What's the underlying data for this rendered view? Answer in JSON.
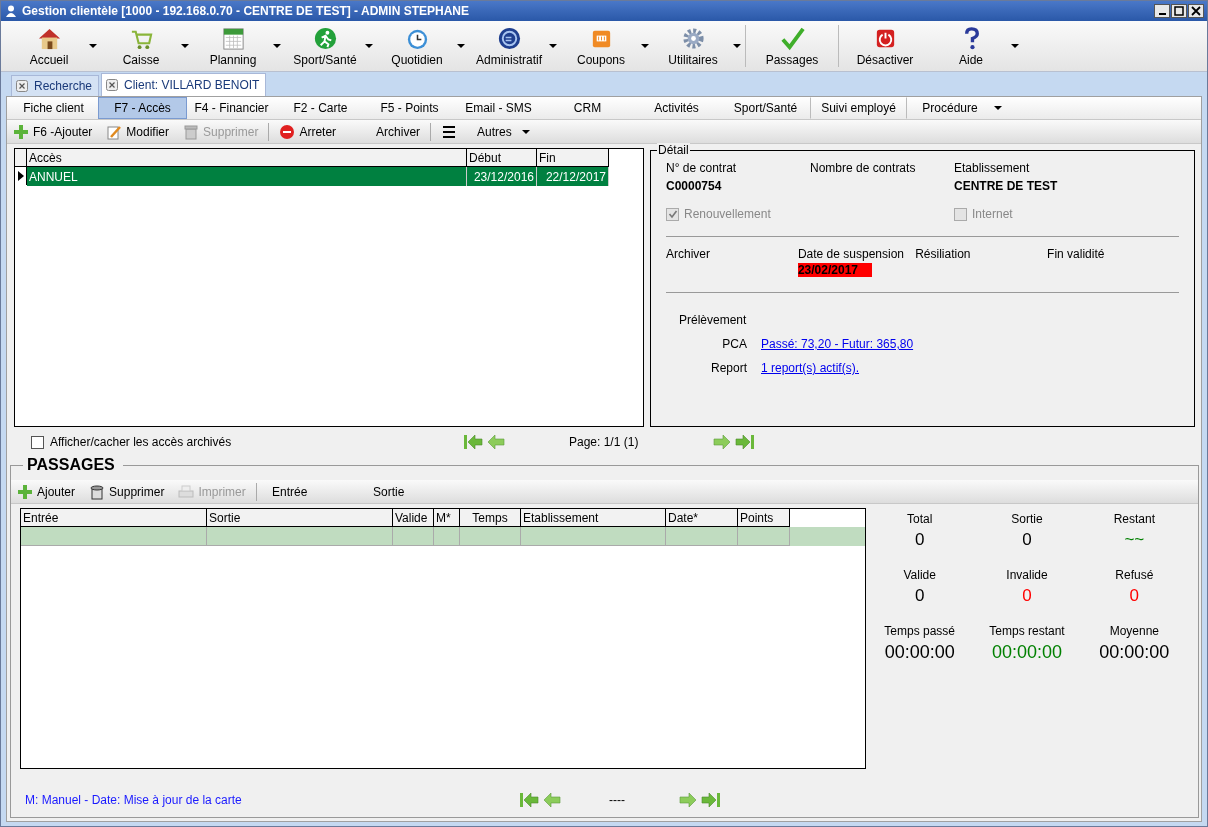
{
  "window": {
    "title": "Gestion clientèle [1000 - 192.168.0.70 - CENTRE DE TEST] - ADMIN STEPHANE"
  },
  "ribbon": [
    {
      "label": "Accueil",
      "dropdown": true
    },
    {
      "label": "Caisse",
      "dropdown": true
    },
    {
      "label": "Planning",
      "dropdown": true
    },
    {
      "label": "Sport/Santé",
      "dropdown": true
    },
    {
      "label": "Quotidien",
      "dropdown": true
    },
    {
      "label": "Administratif",
      "dropdown": true
    },
    {
      "label": "Coupons",
      "dropdown": true
    },
    {
      "label": "Utilitaires",
      "dropdown": true
    },
    {
      "label": "Passages",
      "dropdown": false
    },
    {
      "label": "Désactiver",
      "dropdown": false
    },
    {
      "label": "Aide",
      "dropdown": true
    }
  ],
  "doc_tabs": [
    {
      "label": "Recherche",
      "selected": false
    },
    {
      "label": "Client: VILLARD BENOIT",
      "selected": true
    }
  ],
  "sub_tabs": [
    {
      "label": "Fiche client",
      "selected": false,
      "dropdown": false
    },
    {
      "label": "F7 - Accès",
      "selected": true,
      "dropdown": false
    },
    {
      "label": "F4 - Financier",
      "selected": false,
      "dropdown": false
    },
    {
      "label": "F2 - Carte",
      "selected": false,
      "dropdown": false
    },
    {
      "label": "F5 - Points",
      "selected": false,
      "dropdown": false
    },
    {
      "label": "Email - SMS",
      "selected": false,
      "dropdown": false
    },
    {
      "label": "CRM",
      "selected": false,
      "dropdown": false
    },
    {
      "label": "Activités",
      "selected": false,
      "dropdown": false
    },
    {
      "label": "Sport/Santé",
      "selected": false,
      "dropdown": false
    },
    {
      "label": "Suivi employé",
      "selected": false,
      "dropdown": false
    },
    {
      "label": "Procédure",
      "selected": false,
      "dropdown": true
    }
  ],
  "actions": [
    {
      "label": "F6 -Ajouter",
      "disabled": false,
      "dropdown": false
    },
    {
      "label": "Modifier",
      "disabled": false,
      "dropdown": false
    },
    {
      "label": "Supprimer",
      "disabled": true,
      "dropdown": false
    },
    {
      "label": "Arreter",
      "disabled": false,
      "dropdown": false
    },
    {
      "label": "Archiver",
      "disabled": false,
      "dropdown": false
    },
    {
      "label": "Autres",
      "disabled": false,
      "dropdown": true
    }
  ],
  "access_table": {
    "columns": [
      "Accès",
      "Début",
      "Fin"
    ],
    "rows": [
      {
        "cells": [
          "ANNUEL",
          "23/12/2016",
          "22/12/2017"
        ],
        "selected": true
      }
    ]
  },
  "detail": {
    "title": "Détail",
    "contract_label": "N° de contrat",
    "contract_value": "C0000754",
    "count_label": "Nombre de contrats",
    "establishment_label": "Etablissement",
    "establishment_value": "CENTRE DE TEST",
    "checkboxes": [
      {
        "label": "Renouvellement",
        "checked": true,
        "disabled": true
      },
      {
        "label": "Internet",
        "checked": false,
        "disabled": true
      }
    ],
    "dates": [
      {
        "label": "Archiver"
      },
      {
        "label": "Date de suspension",
        "value": "23/02/2017",
        "alert": true
      },
      {
        "label": "Résiliation"
      },
      {
        "label": "Fin validité"
      }
    ],
    "prelevement_label": "Prélèvement",
    "links": [
      {
        "label": "PCA",
        "value": "Passé: 73,20 - Futur: 365,80"
      },
      {
        "label": "Report",
        "value": "1 report(s) actif(s)."
      }
    ]
  },
  "archived_toggle": {
    "label": "Afficher/cacher les accès archivés",
    "checked": false
  },
  "access_pager": {
    "text": "Page: 1/1 (1)"
  },
  "passages": {
    "title": "PASSAGES",
    "actions": [
      {
        "label": "Ajouter",
        "disabled": false
      },
      {
        "label": "Supprimer",
        "disabled": false
      },
      {
        "label": "Imprimer",
        "disabled": true
      },
      {
        "label": "Entrée",
        "disabled": false
      },
      {
        "label": "Sortie",
        "disabled": false
      }
    ],
    "columns": [
      "Entrée",
      "Sortie",
      "Valide",
      "M*",
      "Temps",
      "Etablissement",
      "Date*",
      "Points"
    ],
    "rows": [
      {
        "selected": true
      }
    ],
    "stats": [
      {
        "label": "Total",
        "value": "0",
        "color": "#000000"
      },
      {
        "label": "Sortie",
        "value": "0",
        "color": "#000000"
      },
      {
        "label": "Restant",
        "value": "~~",
        "color": "#008000"
      },
      {
        "label": "Valide",
        "value": "0",
        "color": "#000000"
      },
      {
        "label": "Invalide",
        "value": "0",
        "color": "#ff0000"
      },
      {
        "label": "Refusé",
        "value": "0",
        "color": "#ff0000"
      },
      {
        "label": "Temps passé",
        "value": "00:00:00",
        "color": "#000000"
      },
      {
        "label": "Temps restant",
        "value": "00:00:00",
        "color": "#008000"
      },
      {
        "label": "Moyenne",
        "value": "00:00:00",
        "color": "#000000"
      }
    ],
    "legend": "M: Manuel - Date: Mise à jour de la carte",
    "pager_text": "----"
  }
}
